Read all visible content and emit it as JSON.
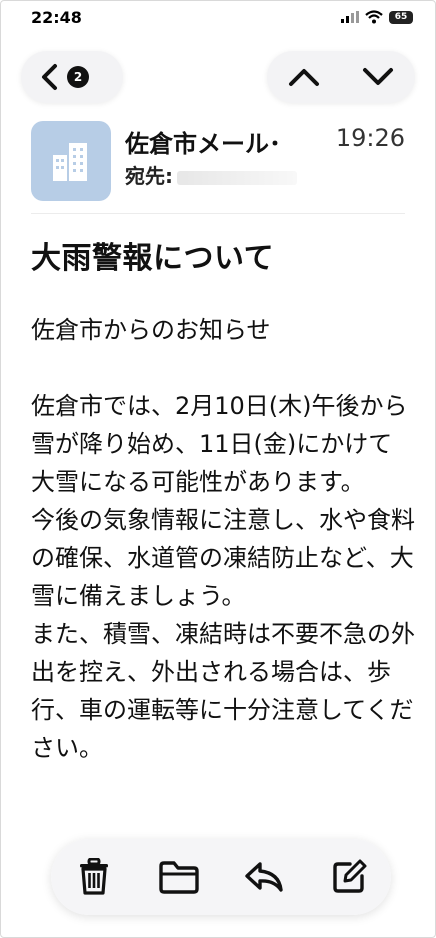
{
  "status_bar": {
    "time": "22:48",
    "battery": "65"
  },
  "nav": {
    "unread_count": "2"
  },
  "message": {
    "sender": "佐倉市メール･",
    "time": "19:26",
    "to_label": "宛先:",
    "subject": "大雨警報について",
    "body": [
      "佐倉市からのお知らせ",
      "",
      "佐倉市では、2月10日(木)午後から雪が降り始め、11日(金)にかけて大雪になる可能性があります。",
      "今後の気象情報に注意し、水や食料の確保、水道管の凍結防止など、大雪に備えましょう。",
      "また、積雪、凍結時は不要不急の外出を控え、外出される場合は、歩行、車の運転等に十分注意してください。"
    ]
  },
  "toolbar_icons": [
    "trash-icon",
    "folder-icon",
    "reply-icon",
    "compose-icon"
  ]
}
